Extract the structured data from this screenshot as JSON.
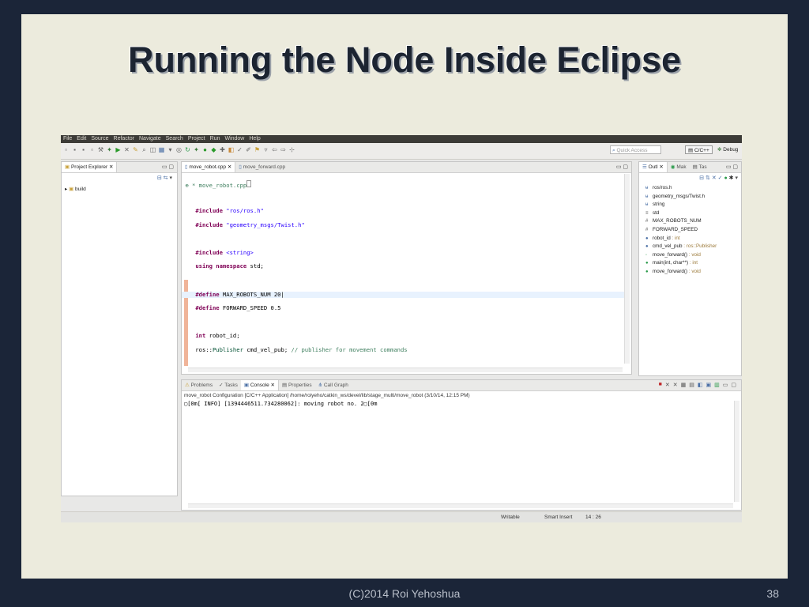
{
  "slide": {
    "title": "Running the Node Inside Eclipse",
    "footer_credit": "(C)2014 Roi Yehoshua",
    "page_number": "38"
  },
  "ide": {
    "menu": [
      "File",
      "Edit",
      "Source",
      "Refactor",
      "Navigate",
      "Search",
      "Project",
      "Run",
      "Window",
      "Help"
    ],
    "quick_access_placeholder": "Quick Access",
    "perspectives": {
      "cpp": "C/C++",
      "debug": "Debug"
    },
    "project_explorer": {
      "tab_label": "Project Explorer",
      "items": [
        "build"
      ]
    },
    "editor": {
      "tabs": [
        "move_robot.cpp",
        "move_forward.cpp"
      ]
    },
    "outline": {
      "tabs": [
        "Outl",
        "Mak",
        "Tas"
      ],
      "items": [
        {
          "name": "ros/ros.h",
          "type": ""
        },
        {
          "name": "geometry_msgs/Twist.h",
          "type": ""
        },
        {
          "name": "string",
          "type": ""
        },
        {
          "name": "std",
          "type": ""
        },
        {
          "name": "MAX_ROBOTS_NUM",
          "type": ""
        },
        {
          "name": "FORWARD_SPEED",
          "type": ""
        },
        {
          "name": "robot_id",
          "type": ": int"
        },
        {
          "name": "cmd_vel_pub",
          "type": ": ros::Publisher"
        },
        {
          "name": "move_forward()",
          "type": ": void"
        },
        {
          "name": "main(int, char**)",
          "type": ": int"
        },
        {
          "name": "move_forward()",
          "type": ": void"
        }
      ]
    },
    "console": {
      "tabs": [
        "Problems",
        "Tasks",
        "Console",
        "Properties",
        "Call Graph"
      ],
      "description": "move_robot Configuration [C/C++ Application] /home/roiyeho/catkin_ws/devel/lib/stage_multi/move_robot (3/10/14, 12:15 PM)",
      "output": "▢[0m[ INFO] [1394446511.734280062]: moving robot no. 2▢[0m"
    },
    "status": {
      "writable": "Writable",
      "insert": "Smart Insert",
      "position": "14 : 26"
    }
  }
}
